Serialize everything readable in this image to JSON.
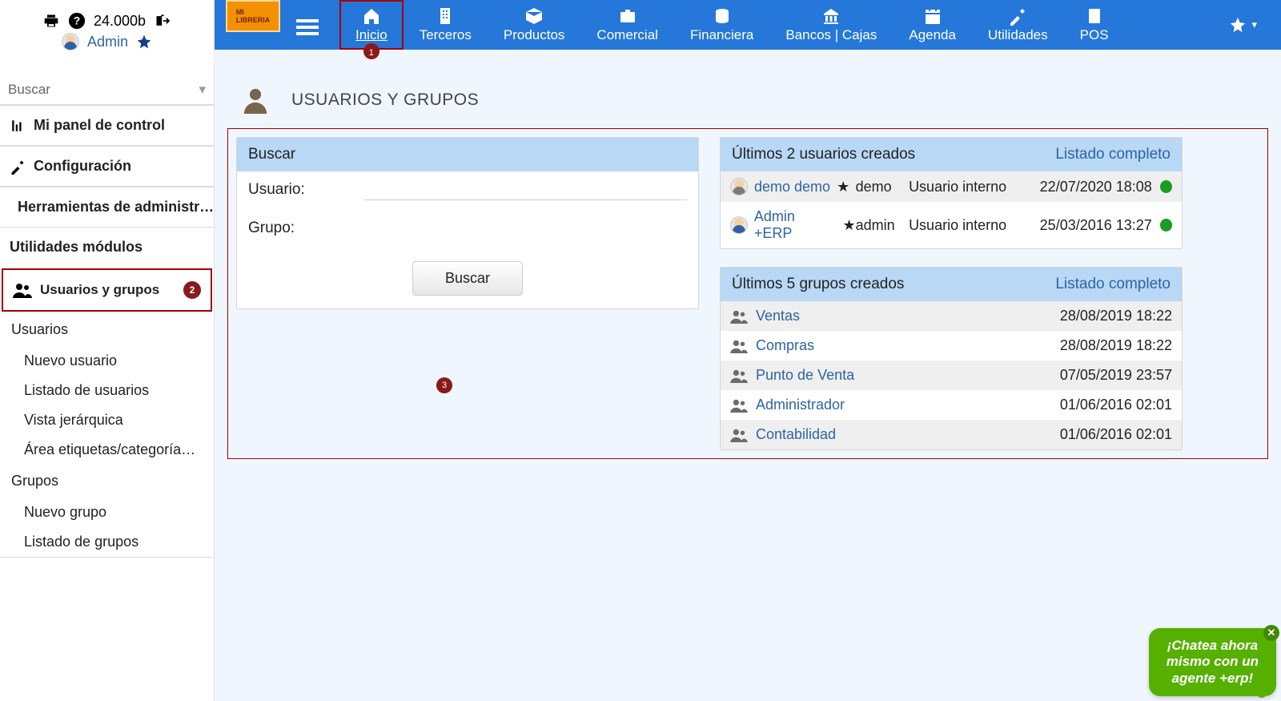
{
  "topleft": {
    "version": "24.000b",
    "user": "Admin"
  },
  "sidebar_search": "Buscar",
  "topnav": [
    {
      "label": "Inicio",
      "active": true,
      "badge": "1",
      "icon": "home"
    },
    {
      "label": "Terceros",
      "icon": "building"
    },
    {
      "label": "Productos",
      "icon": "box"
    },
    {
      "label": "Comercial",
      "icon": "briefcase"
    },
    {
      "label": "Financiera",
      "icon": "coins"
    },
    {
      "label": "Bancos | Cajas",
      "icon": "bank"
    },
    {
      "label": "Agenda",
      "icon": "calendar"
    },
    {
      "label": "Utilidades",
      "icon": "wrench"
    },
    {
      "label": "POS",
      "icon": "pos"
    }
  ],
  "sidebar": {
    "dashboard": "Mi panel de control",
    "config": "Configuración",
    "admintools": "Herramientas de administr…",
    "utilmods": "Utilidades módulos",
    "usersgroups": {
      "label": "Usuarios y grupos",
      "badge": "2"
    },
    "users_head": "Usuarios",
    "users_items": [
      "Nuevo usuario",
      "Listado de usuarios",
      "Vista jerárquica",
      "Área etiquetas/categorías Us…"
    ],
    "groups_head": "Grupos",
    "groups_items": [
      "Nuevo grupo",
      "Listado de grupos"
    ]
  },
  "page_title": "USUARIOS Y GRUPOS",
  "search_card": {
    "title": "Buscar",
    "user_label": "Usuario:",
    "group_label": "Grupo:",
    "button": "Buscar",
    "center_badge": "3"
  },
  "latest_users": {
    "title": "Últimos 2 usuarios creados",
    "link": "Listado completo",
    "rows": [
      {
        "name": "demo demo",
        "login": "demo",
        "type": "Usuario interno",
        "date": "22/07/2020 18:08",
        "avatar": "gray"
      },
      {
        "name": "Admin +ERP",
        "login": "admin",
        "type": "Usuario interno",
        "date": "25/03/2016 13:27",
        "avatar": "blue"
      }
    ]
  },
  "latest_groups": {
    "title": "Últimos 5 grupos creados",
    "link": "Listado completo",
    "rows": [
      {
        "name": "Ventas",
        "date": "28/08/2019 18:22"
      },
      {
        "name": "Compras",
        "date": "28/08/2019 18:22"
      },
      {
        "name": "Punto de Venta",
        "date": "07/05/2019 23:57"
      },
      {
        "name": "Administrador",
        "date": "01/06/2016 02:01"
      },
      {
        "name": "Contabilidad",
        "date": "01/06/2016 02:01"
      }
    ]
  },
  "chat": {
    "text1": "¡Chatea ahora",
    "text2": "mismo con un",
    "text3": "agente +erp!"
  }
}
